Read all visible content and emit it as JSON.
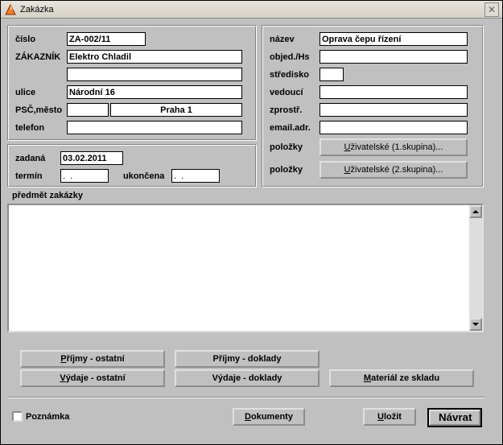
{
  "window": {
    "title": "Zakázka"
  },
  "left": {
    "cislo_label": "číslo",
    "cislo": "ZA-002/11",
    "zakaznik_label": "ZÁKAZNÍK",
    "zakaznik": "Elektro Chladil",
    "zakaznik2": "",
    "ulice_label": "ulice",
    "ulice": "Národní 16",
    "psc_label": "PSČ,město",
    "psc": "",
    "mesto": "Praha 1",
    "telefon_label": "telefon",
    "telefon": ""
  },
  "dates": {
    "zadana_label": "zadaná",
    "zadana": "03.02.2011",
    "termin_label": "termín",
    "termin": ".  .",
    "ukoncena_label": "ukončena",
    "ukoncena": ".  ."
  },
  "right": {
    "nazev_label": "název",
    "nazev": "Oprava čepu řízení",
    "objed_label": "objed./Hs",
    "objed": "",
    "stredisko_label": "středisko",
    "stredisko": "",
    "vedouci_label": "vedoucí",
    "vedouci": "",
    "zprostr_label": "zprostř.",
    "zprostr": "",
    "email_label": "email.adr.",
    "email": "",
    "polozky1_label": "položky",
    "polozky1_btn": "Uživatelské (1.skupina)...",
    "polozky2_label": "položky",
    "polozky2_btn": "Uživatelské (2.skupina)..."
  },
  "subject": {
    "label": "předmět zakázky",
    "text": ""
  },
  "buttons": {
    "prijmy_ostatni": "Příjmy - ostatní",
    "prijmy_doklady": "Příjmy - doklady",
    "vydaje_ostatni": "Výdaje - ostatní",
    "vydaje_doklady": "Výdaje - doklady",
    "material": "Materiál ze skladu",
    "poznamka": "Poznámka",
    "dokumenty": "Dokumenty",
    "ulozit": "Uložit",
    "navrat": "Návrat"
  }
}
